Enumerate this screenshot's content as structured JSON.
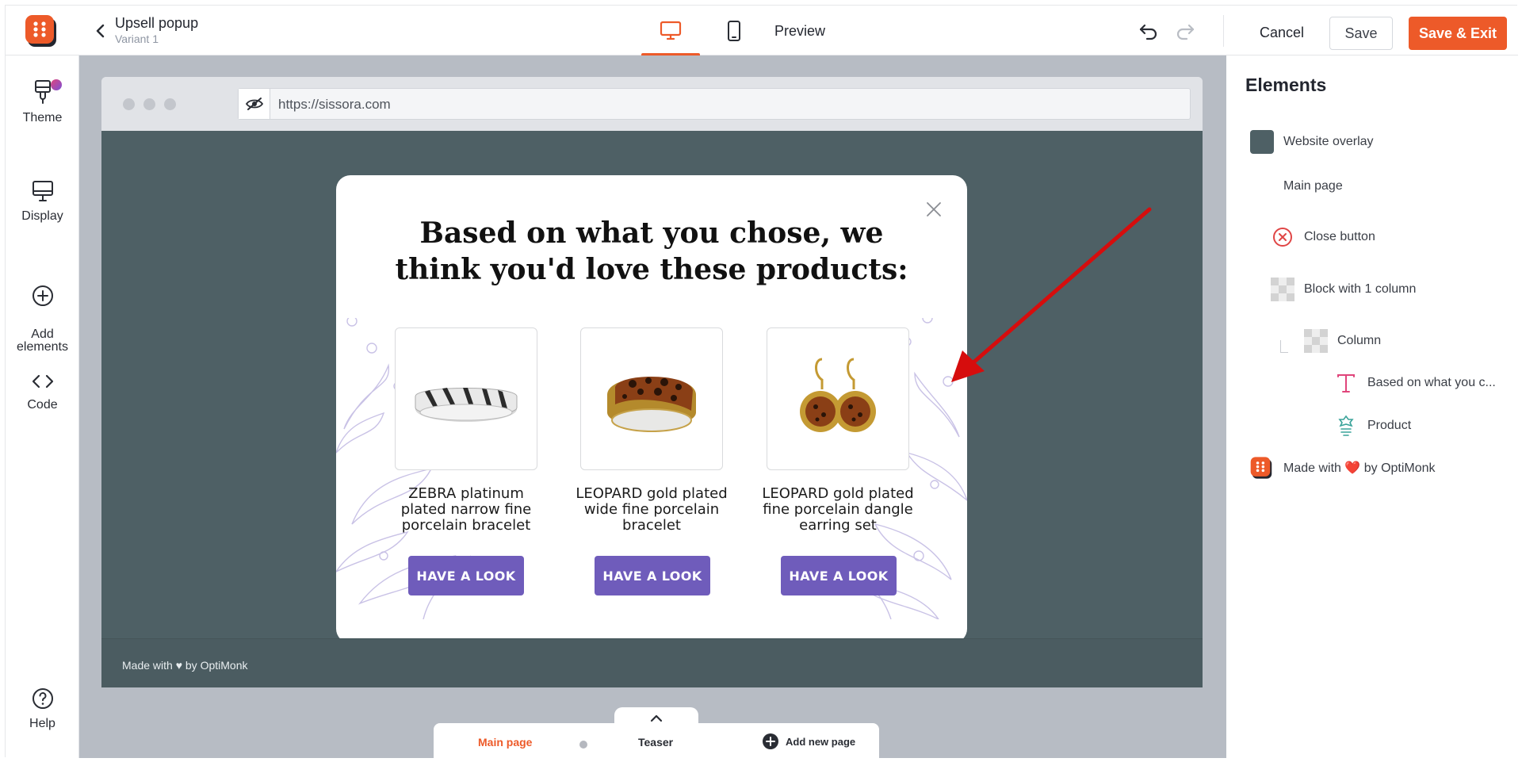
{
  "header": {
    "campaign_title": "Upsell popup",
    "variant": "Variant 1",
    "preview_label": "Preview",
    "cancel_label": "Cancel",
    "save_label": "Save",
    "save_exit_label": "Save & Exit"
  },
  "sidebar": {
    "items": [
      {
        "label": "Theme",
        "icon": "paintbrush-icon"
      },
      {
        "label": "Display",
        "icon": "monitor-icon"
      },
      {
        "label": "Add\nelements",
        "icon": "plus-circle-icon"
      },
      {
        "label": "Code",
        "icon": "code-icon"
      },
      {
        "label": "Help",
        "icon": "question-icon"
      }
    ]
  },
  "browser": {
    "url": "https://sissora.com"
  },
  "popup": {
    "headline": "Based on what you chose, we think you'd love these products:",
    "products": [
      {
        "name": "ZEBRA platinum plated narrow fine porcelain bracelet",
        "button": "HAVE A LOOK"
      },
      {
        "name": "LEOPARD gold plated wide fine porcelain bracelet",
        "button": "HAVE A LOOK"
      },
      {
        "name": "LEOPARD gold plated fine porcelain dangle earring set",
        "button": "HAVE A LOOK"
      }
    ],
    "footer_made_with": "Made with ♥ by OptiMonk"
  },
  "pages": {
    "main_page": "Main page",
    "teaser": "Teaser",
    "add_new_page": "Add new page"
  },
  "elements_panel": {
    "title": "Elements",
    "layers": [
      {
        "label": "Website overlay"
      },
      {
        "label": "Main page"
      },
      {
        "label": "Close button"
      },
      {
        "label": "Block with 1 column"
      },
      {
        "label": "Column"
      },
      {
        "label": "Based on what you c..."
      },
      {
        "label": "Product"
      },
      {
        "label": "Made with ❤️ by OptiMonk"
      }
    ]
  },
  "colors": {
    "accent": "#ed5a29",
    "overlay": "#4e6065",
    "button": "#6f5cbb"
  }
}
